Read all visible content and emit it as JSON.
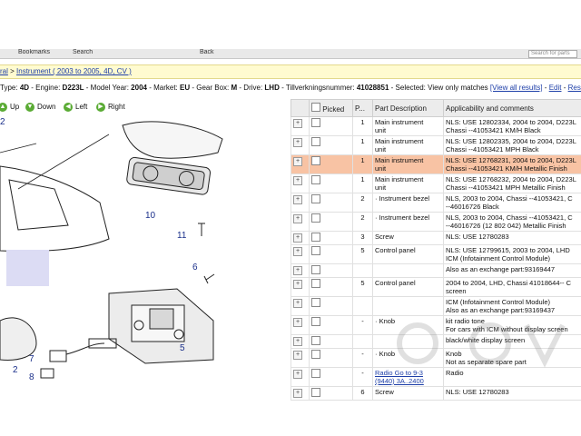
{
  "topbar": {
    "item1": "Bookmarks",
    "item2": "Search",
    "item3": "Back",
    "search_placeholder": "Search for parts"
  },
  "breadcrumb": {
    "lead": "ral",
    "sep": " > ",
    "model_link": "Instrument ( 2003 to 2005, 4D, CV )"
  },
  "info": {
    "body_label": "Type:",
    "body": "4D",
    "engine_label": "- Engine:",
    "engine": "D223L",
    "model_year_label": "- Model Year:",
    "model_year": "2004",
    "market_label": "- Market:",
    "market": "EU",
    "gearbox_label": "- Gear Box:",
    "gearbox": "M",
    "drive_label": "- Drive:",
    "drive": "LHD",
    "tillv_label": "- Tillverkningsnummer:",
    "tillv": "41028851",
    "selected_label": "- Selected:",
    "selected": "View only matches",
    "view_all": "[View all results]",
    "edit": "Edit",
    "reset": "Reset"
  },
  "nav": {
    "up": "Up",
    "down": "Down",
    "left": "Left",
    "right": "Right"
  },
  "diagram": {
    "callouts": [
      "2",
      "10",
      "11",
      "6",
      "5",
      "2",
      "7",
      "8"
    ]
  },
  "table": {
    "headers": {
      "picked": "Picked",
      "pos": "P...",
      "desc": "Part Description",
      "applic": "Applicability and comments"
    },
    "rows": [
      {
        "pos": "1",
        "desc1": "Main instrument",
        "desc2": "unit",
        "app1": "NLS: USE 12802334, 2004 to 2004, D223L",
        "app2": "Chassi --41053421 KM/H Black",
        "hl": false
      },
      {
        "pos": "1",
        "desc1": "Main instrument",
        "desc2": "unit",
        "app1": "NLS: USE 12802335, 2004 to 2004, D223L",
        "app2": "Chassi --41053421 MPH Black",
        "hl": false
      },
      {
        "pos": "1",
        "desc1": "Main instrument",
        "desc2": "unit",
        "app1": "NLS: USE 12768231, 2004 to 2004, D223L",
        "app2": "Chassi --41053421 KM/H Metallic Finish",
        "hl": true
      },
      {
        "pos": "1",
        "desc1": "Main instrument",
        "desc2": "unit",
        "app1": "NLS: USE 12768232, 2004 to 2004, D223L",
        "app2": "Chassi --41053421 MPH Metallic Finish",
        "hl": false
      },
      {
        "pos": "2",
        "desc1": "· Instrument bezel",
        "desc2": "",
        "app1": "NLS, 2003 to 2004, Chassi --41053421, C",
        "app2": "--46016726 Black",
        "hl": false
      },
      {
        "pos": "2",
        "desc1": "· Instrument bezel",
        "desc2": "",
        "app1": "NLS, 2003 to 2004, Chassi --41053421, C",
        "app2": "--46016726 (12 802 042) Metallic Finish",
        "hl": false
      },
      {
        "pos": "3",
        "desc1": "Screw",
        "desc2": "",
        "app1": "NLS: USE 12780283",
        "app2": "",
        "hl": false
      },
      {
        "pos": "5",
        "desc1": "Control panel",
        "desc2": "",
        "app1": "NLS: USE 12799615, 2003 to 2004, LHD",
        "app2": "ICM (Infotainment Control Module)",
        "hl": false
      },
      {
        "pos": "",
        "desc1": "",
        "desc2": "",
        "app1": "Also as an exchange part:93169447",
        "app2": "",
        "hl": false
      },
      {
        "pos": "5",
        "desc1": "Control panel",
        "desc2": "",
        "app1": "2004 to 2004, LHD, Chassi 41018644-- C",
        "app2": "screen",
        "hl": false
      },
      {
        "pos": "",
        "desc1": "",
        "desc2": "",
        "app1": "ICM (Infotainment Control Module)",
        "app2": "Also as an exchange part:93169437",
        "hl": false
      },
      {
        "pos": "-",
        "desc1": "· Knob",
        "desc2": "",
        "app1": "kit radio tone",
        "app2": "For cars with ICM without display screen",
        "hl": false
      },
      {
        "pos": "",
        "desc1": "",
        "desc2": "",
        "app1": "black/white display screen",
        "app2": "",
        "hl": false
      },
      {
        "pos": "-",
        "desc1": "· Knob",
        "desc2": "",
        "app1": "Knob",
        "app2": "Not as separate spare part",
        "hl": false
      },
      {
        "pos": "-",
        "desc1": "Radio Go to 9-3",
        "desc2": "(9440) 3A..2400",
        "app1": "Radio",
        "app2": "",
        "hl": false,
        "link": true
      },
      {
        "pos": "6",
        "desc1": "Screw",
        "desc2": "",
        "app1": "NLS: USE 12780283",
        "app2": "",
        "hl": false
      }
    ]
  },
  "colors": {
    "highlight": "#f8c3a4",
    "crumb_bg": "#fffbd0",
    "link": "#1e3fa8",
    "nav_arrow": "#5aab34"
  }
}
